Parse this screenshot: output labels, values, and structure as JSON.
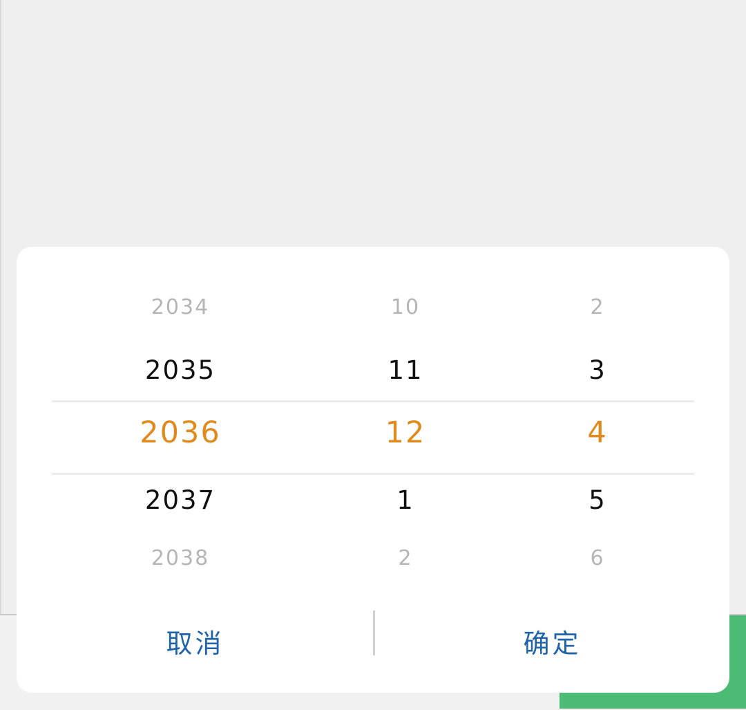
{
  "date_picker": {
    "columns": {
      "year": {
        "items": [
          "2034",
          "2035",
          "2036",
          "2037",
          "2038"
        ],
        "selected": "2036"
      },
      "month": {
        "items": [
          "10",
          "11",
          "12",
          "1",
          "2"
        ],
        "selected": "12"
      },
      "day": {
        "items": [
          "2",
          "3",
          "4",
          "5",
          "6"
        ],
        "selected": "4"
      }
    },
    "actions": {
      "cancel_label": "取消",
      "confirm_label": "确定"
    }
  },
  "colors": {
    "selected": "#e08a1b",
    "action": "#1f63a8",
    "green_button": "#4cbb73",
    "background": "#efefef"
  }
}
